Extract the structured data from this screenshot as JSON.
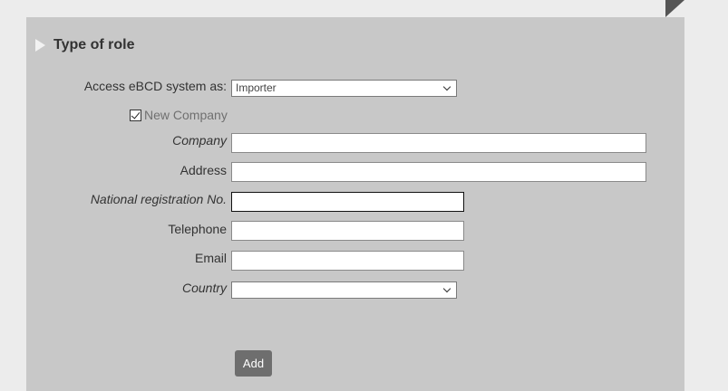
{
  "section": {
    "title": "Type of role"
  },
  "form": {
    "access_label": "Access eBCD system as:",
    "access_value": "Importer",
    "new_company_label": "New Company",
    "company_label": "Company",
    "company_value": "",
    "address_label": "Address",
    "address_value": "",
    "national_reg_label": "National registration No.",
    "national_reg_value": "",
    "telephone_label": "Telephone",
    "telephone_value": "",
    "email_label": "Email",
    "email_value": "",
    "country_label": "Country",
    "country_value": "",
    "add_label": "Add"
  },
  "icons": {
    "section_toggle": "triangle-right-icon",
    "select_arrow": "chevron-down-icon",
    "checkbox": "checkmark-icon"
  },
  "colors": {
    "panel_bg": "#c8c8c8",
    "page_bg": "#ececec",
    "button_bg": "#6e6e6e"
  },
  "state": {
    "new_company_checked": true,
    "focused_field": "national_reg"
  }
}
